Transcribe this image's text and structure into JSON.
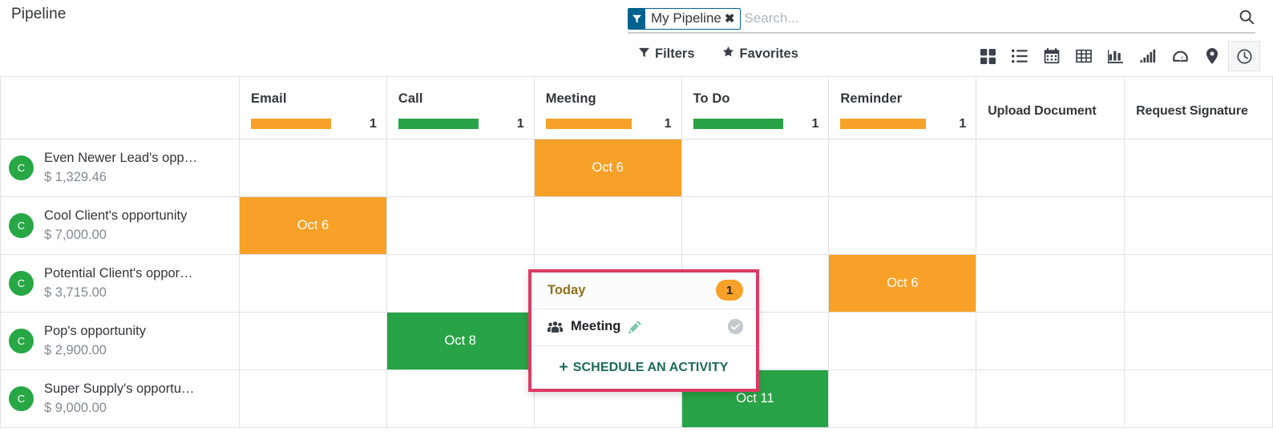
{
  "breadcrumb": "Pipeline",
  "search": {
    "facet_label": "My Pipeline",
    "facet_icon": "filter-icon",
    "facet_close_glyph": "✖",
    "placeholder": "Search...",
    "value": "",
    "magnifier_icon": "search-icon"
  },
  "dropdowns": [
    {
      "label": "Filters",
      "icon": "filter-icon"
    },
    {
      "label": "Favorites",
      "icon": "star-icon"
    }
  ],
  "view_switcher": {
    "active": "activity",
    "buttons": [
      {
        "key": "kanban",
        "icon": "kanban-icon",
        "active": false
      },
      {
        "key": "list",
        "icon": "list-icon",
        "active": false
      },
      {
        "key": "calendar",
        "icon": "calendar-icon",
        "active": false
      },
      {
        "key": "pivot",
        "icon": "pivot-table-icon",
        "active": false
      },
      {
        "key": "graph",
        "icon": "bar-chart-icon",
        "active": false
      },
      {
        "key": "cohort",
        "icon": "cohort-icon",
        "active": false
      },
      {
        "key": "dashboard",
        "icon": "gauge-icon",
        "active": false
      },
      {
        "key": "map",
        "icon": "map-pin-icon",
        "active": false
      },
      {
        "key": "activity",
        "icon": "clock-icon",
        "active": true
      }
    ]
  },
  "colors": {
    "orange": "#f7a128",
    "green": "#29a347",
    "highlight_border": "#dd3a67",
    "avatar": "#28a745",
    "facet_blue": "#00628f",
    "link_teal": "#196a5a"
  },
  "grid": {
    "columns": [
      {
        "label": "Email",
        "count": "1",
        "bar_color": "#f7a128",
        "bar_pct": 72,
        "has_bar": true
      },
      {
        "label": "Call",
        "count": "1",
        "bar_color": "#29a347",
        "bar_pct": 72,
        "has_bar": true
      },
      {
        "label": "Meeting",
        "count": "1",
        "bar_color": "#f7a128",
        "bar_pct": 77,
        "has_bar": true
      },
      {
        "label": "To Do",
        "count": "1",
        "bar_color": "#29a347",
        "bar_pct": 81,
        "has_bar": true
      },
      {
        "label": "Reminder",
        "count": "1",
        "bar_color": "#f7a128",
        "bar_pct": 77,
        "has_bar": true
      },
      {
        "label": "Upload Document",
        "count": "",
        "bar_color": "",
        "bar_pct": 0,
        "has_bar": false
      },
      {
        "label": "Request Signature",
        "count": "",
        "bar_color": "",
        "bar_pct": 0,
        "has_bar": false
      }
    ],
    "rows": [
      {
        "avatar_letter": "C",
        "name": "Even Newer Lead's opp…",
        "amount": "$ 1,329.46",
        "cells": [
          {
            "label": "",
            "state": "empty"
          },
          {
            "label": "",
            "state": "empty"
          },
          {
            "label": "Oct 6",
            "state": "orange"
          },
          {
            "label": "",
            "state": "empty"
          },
          {
            "label": "",
            "state": "empty"
          },
          {
            "label": "",
            "state": "empty"
          },
          {
            "label": "",
            "state": "empty"
          }
        ]
      },
      {
        "avatar_letter": "C",
        "name": "Cool Client's opportunity",
        "amount": "$ 7,000.00",
        "cells": [
          {
            "label": "Oct 6",
            "state": "orange"
          },
          {
            "label": "",
            "state": "empty"
          },
          {
            "label": "",
            "state": "empty"
          },
          {
            "label": "",
            "state": "empty"
          },
          {
            "label": "",
            "state": "empty"
          },
          {
            "label": "",
            "state": "empty"
          },
          {
            "label": "",
            "state": "empty"
          }
        ]
      },
      {
        "avatar_letter": "C",
        "name": "Potential Client's oppor…",
        "amount": "$ 3,715.00",
        "cells": [
          {
            "label": "",
            "state": "empty"
          },
          {
            "label": "",
            "state": "empty"
          },
          {
            "label": "",
            "state": "empty"
          },
          {
            "label": "",
            "state": "empty"
          },
          {
            "label": "Oct 6",
            "state": "orange"
          },
          {
            "label": "",
            "state": "empty"
          },
          {
            "label": "",
            "state": "empty"
          }
        ]
      },
      {
        "avatar_letter": "C",
        "name": "Pop's opportunity",
        "amount": "$ 2,900.00",
        "cells": [
          {
            "label": "",
            "state": "empty"
          },
          {
            "label": "Oct 8",
            "state": "green"
          },
          {
            "label": "",
            "state": "empty"
          },
          {
            "label": "",
            "state": "empty"
          },
          {
            "label": "",
            "state": "empty"
          },
          {
            "label": "",
            "state": "empty"
          },
          {
            "label": "",
            "state": "empty"
          }
        ]
      },
      {
        "avatar_letter": "C",
        "name": "Super Supply's opportu…",
        "amount": "$ 9,000.00",
        "cells": [
          {
            "label": "",
            "state": "empty"
          },
          {
            "label": "",
            "state": "empty"
          },
          {
            "label": "",
            "state": "empty"
          },
          {
            "label": "Oct 11",
            "state": "green"
          },
          {
            "label": "",
            "state": "empty"
          },
          {
            "label": "",
            "state": "empty"
          },
          {
            "label": "",
            "state": "empty"
          }
        ]
      }
    ]
  },
  "popover": {
    "title": "Today",
    "badge": "1",
    "activity": {
      "type_icon": "users-icon",
      "name": "Meeting",
      "edit_icon": "pencil-icon",
      "done_icon": "check-circle-icon"
    },
    "schedule_label": "SCHEDULE AN ACTIVITY",
    "schedule_plus": "+"
  }
}
